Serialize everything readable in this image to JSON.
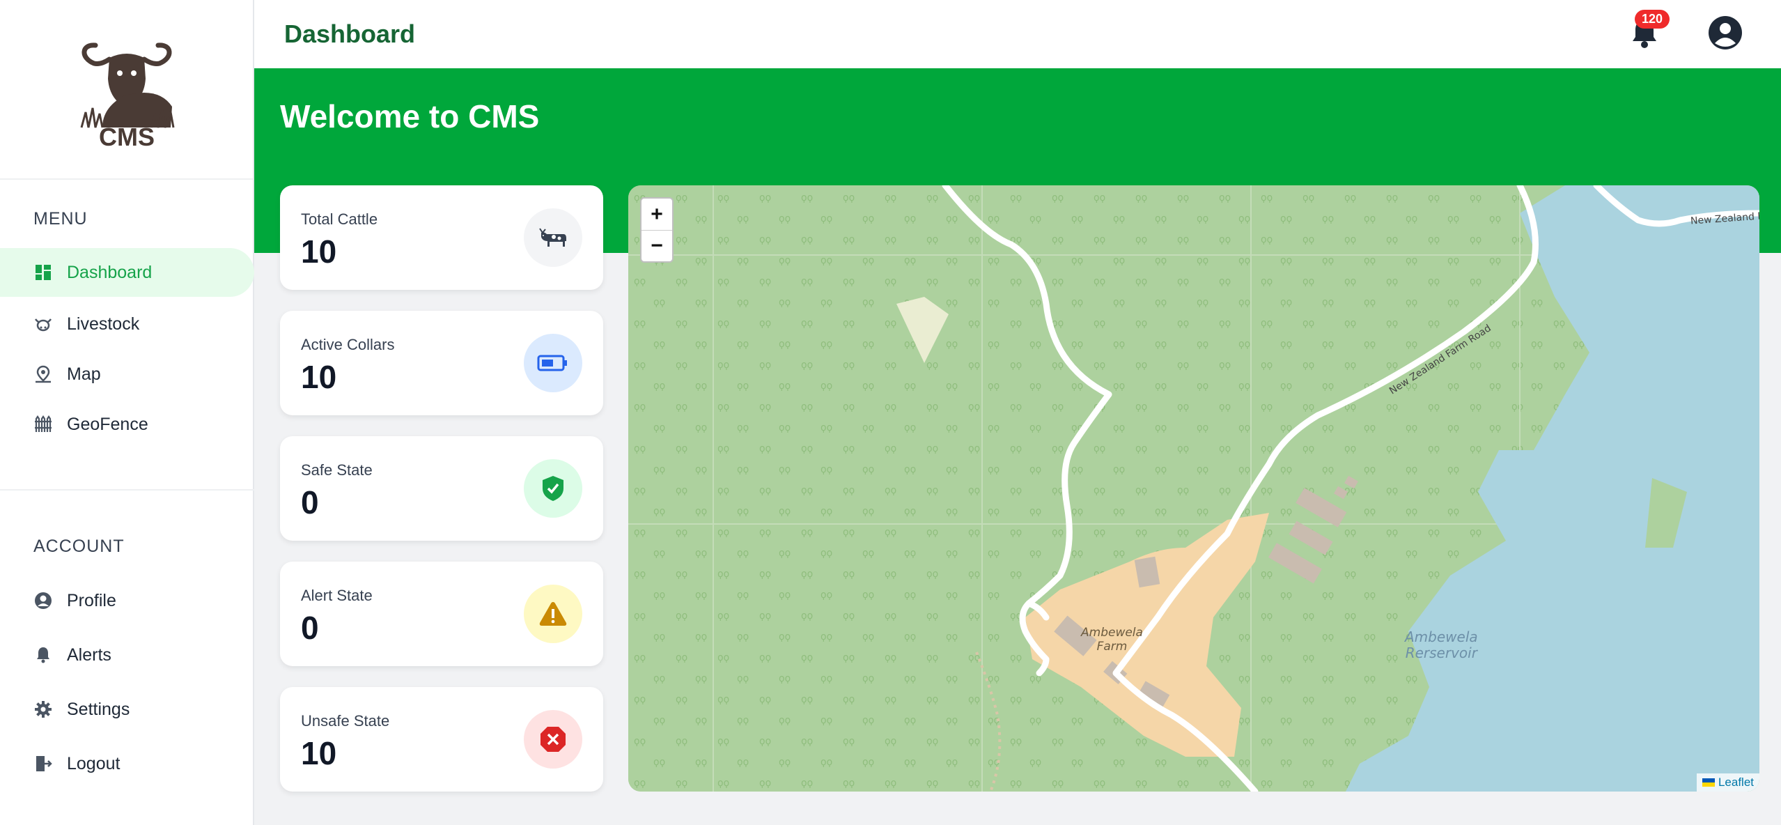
{
  "app": {
    "logo_text": "CMS",
    "page_title": "Dashboard",
    "welcome": "Welcome to CMS"
  },
  "header": {
    "notification_count": "120",
    "bell_icon": "bell-icon",
    "avatar_icon": "user-circle-icon"
  },
  "sidebar": {
    "menu_title": "MENU",
    "menu_items": [
      {
        "label": "Dashboard",
        "icon": "dashboard-icon",
        "active": true
      },
      {
        "label": "Livestock",
        "icon": "cow-icon",
        "active": false
      },
      {
        "label": "Map",
        "icon": "map-pin-icon",
        "active": false
      },
      {
        "label": "GeoFence",
        "icon": "fence-icon",
        "active": false
      }
    ],
    "account_title": "ACCOUNT",
    "account_items": [
      {
        "label": "Profile",
        "icon": "user-icon"
      },
      {
        "label": "Alerts",
        "icon": "bell-icon"
      },
      {
        "label": "Settings",
        "icon": "gear-icon"
      },
      {
        "label": "Logout",
        "icon": "logout-icon"
      }
    ]
  },
  "stats": [
    {
      "label": "Total Cattle",
      "value": "10",
      "icon": "cow-icon",
      "color": "#f3f4f6"
    },
    {
      "label": "Active Collars",
      "value": "10",
      "icon": "battery-icon",
      "color": "#dbeafe"
    },
    {
      "label": "Safe State",
      "value": "0",
      "icon": "shield-check-icon",
      "color": "#dcfce7"
    },
    {
      "label": "Alert State",
      "value": "0",
      "icon": "warning-icon",
      "color": "#fef9c3"
    },
    {
      "label": "Unsafe State",
      "value": "10",
      "icon": "x-octagon-icon",
      "color": "#fee2e2"
    }
  ],
  "map": {
    "zoom_in": "+",
    "zoom_out": "−",
    "attribution": "Leaflet",
    "labels": {
      "farm": "Ambewela\nFarm",
      "reservoir": "Ambewela\nRerservoir",
      "road1": "New Zealand Farm Road",
      "road2": "New Zealand F"
    }
  },
  "colors": {
    "brand_green": "#00a73b",
    "title_green": "#166534",
    "active_bg": "#e6fbeb",
    "badge_red": "#ef2b2b"
  }
}
